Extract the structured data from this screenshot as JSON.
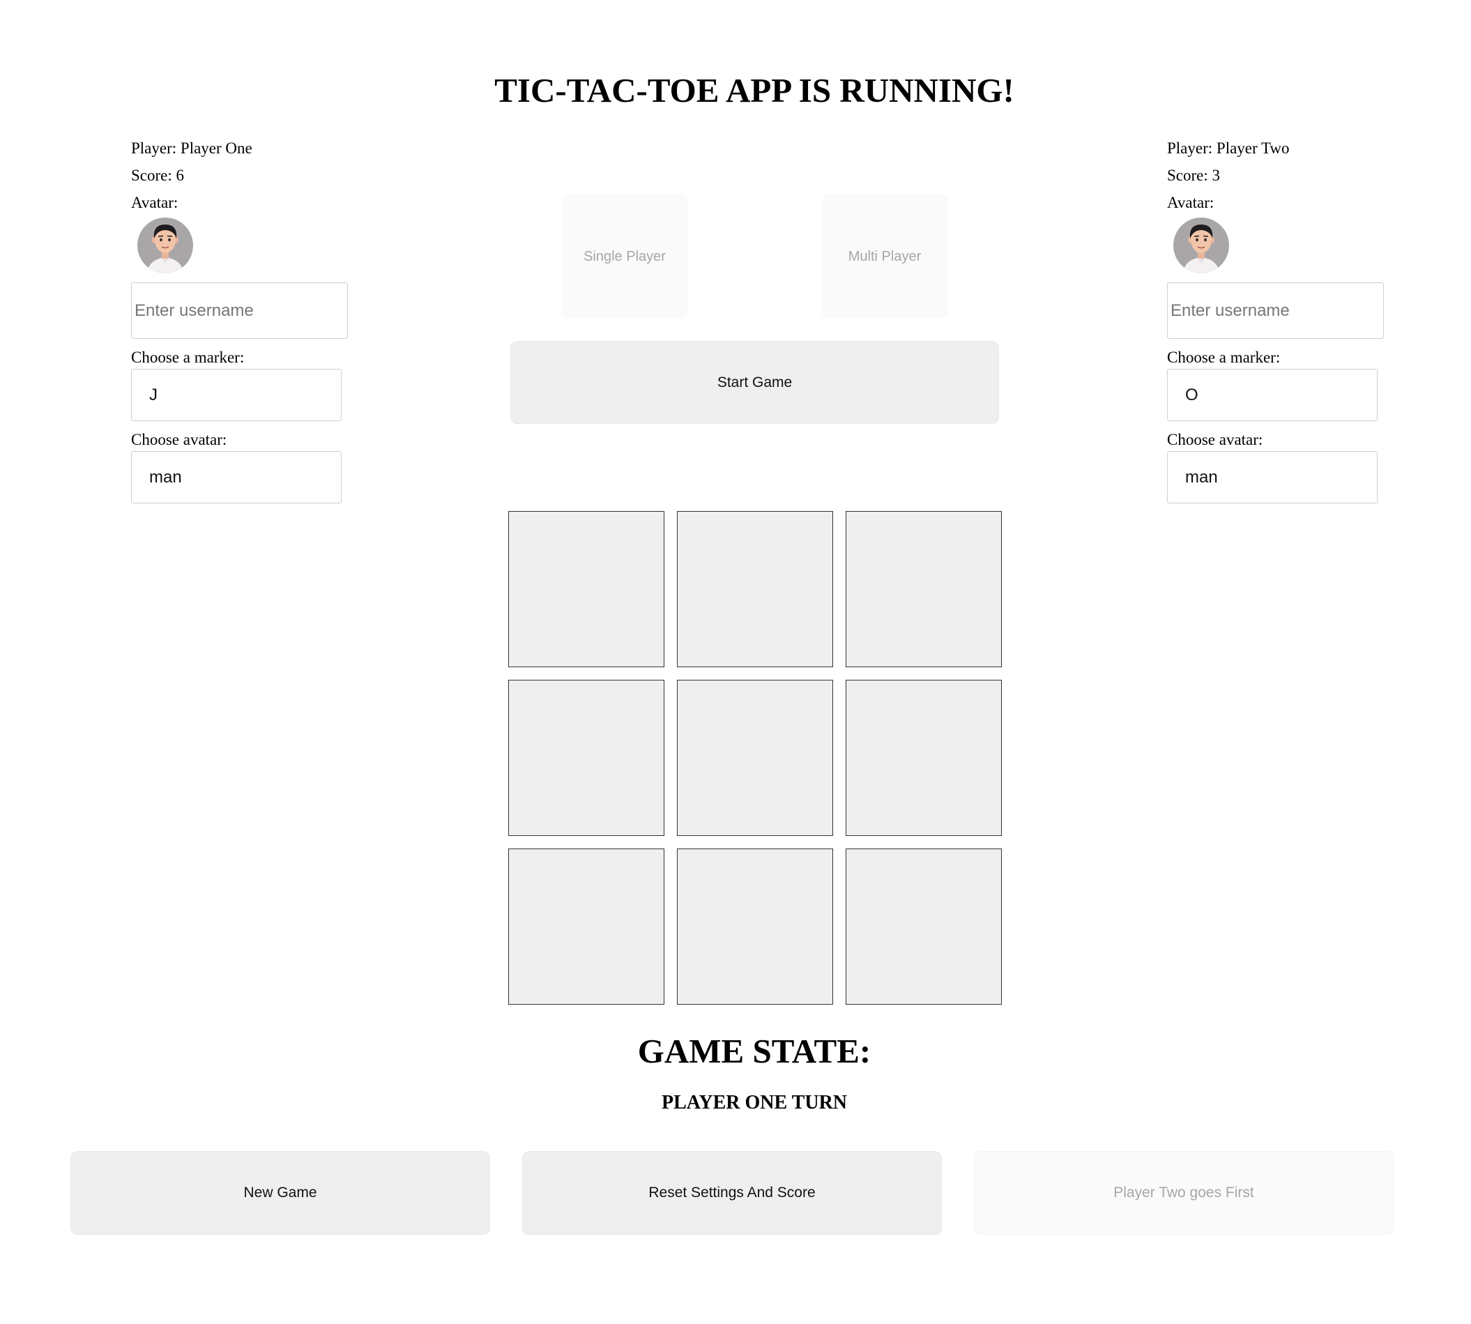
{
  "app": {
    "title": "TIC-TAC-TOE APP IS RUNNING!"
  },
  "player_one": {
    "player_label": "Player: Player One",
    "score_label": "Score: 6",
    "avatar_label": "Avatar:",
    "avatar_icon": "man-avatar-icon",
    "username_placeholder": "Enter username",
    "username_value": "",
    "marker_label": "Choose a marker:",
    "marker_value": "J",
    "avatar_select_label": "Choose avatar:",
    "avatar_value": "man"
  },
  "player_two": {
    "player_label": "Player: Player Two",
    "score_label": "Score: 3",
    "avatar_label": "Avatar:",
    "avatar_icon": "man-avatar-icon",
    "username_placeholder": "Enter username",
    "username_value": "",
    "marker_label": "Choose a marker:",
    "marker_value": "O",
    "avatar_select_label": "Choose avatar:",
    "avatar_value": "man"
  },
  "mode": {
    "single_label": "Single Player",
    "multi_label": "Multi Player"
  },
  "controls": {
    "start_label": "Start Game",
    "new_game_label": "New Game",
    "reset_label": "Reset Settings And Score",
    "first_label": "Player Two goes First"
  },
  "board": {
    "cells": [
      "",
      "",
      "",
      "",
      "",
      "",
      "",
      "",
      ""
    ]
  },
  "game_state": {
    "title": "GAME STATE:",
    "status": "PLAYER ONE TURN"
  },
  "colors": {
    "button_bg": "#efefef",
    "disabled_bg": "#fafafa",
    "disabled_text": "#a6a6a6",
    "cell_bg": "#efefef",
    "cell_border": "#333333"
  }
}
